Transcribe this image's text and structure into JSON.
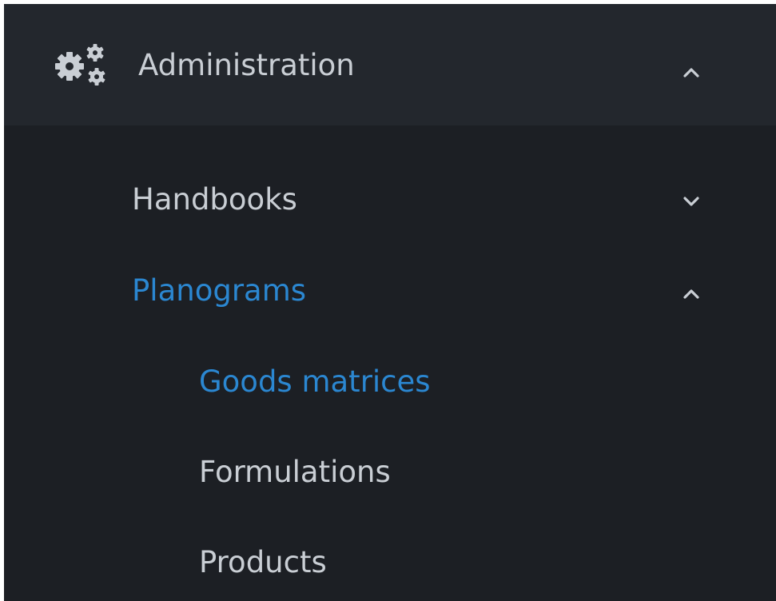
{
  "menu": {
    "section": {
      "label": "Administration",
      "icon": "gears-icon",
      "expanded": true
    },
    "items": [
      {
        "label": "Handbooks",
        "expanded": false,
        "active": false
      },
      {
        "label": "Planograms",
        "expanded": true,
        "active": true,
        "children": [
          {
            "label": "Goods matrices",
            "active": true
          },
          {
            "label": "Formulations",
            "active": false
          },
          {
            "label": "Products",
            "active": false
          }
        ]
      }
    ]
  },
  "colors": {
    "header_bg": "#23272d",
    "panel_bg": "#1c1f24",
    "text": "#c9ced4",
    "accent": "#2b87d1"
  }
}
